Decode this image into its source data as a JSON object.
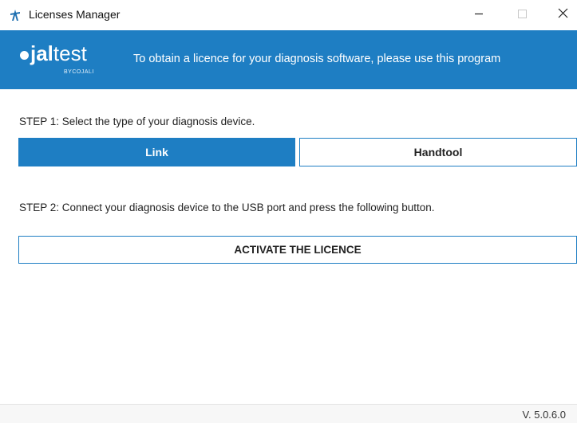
{
  "window": {
    "title": "Licenses Manager",
    "controls": {
      "minimize_icon": "minimize-icon",
      "maximize_icon": "maximize-icon",
      "close_icon": "close-icon"
    }
  },
  "header": {
    "logo": {
      "main_bold": "jal",
      "main_light": "test",
      "sub": "BYCOJALI"
    },
    "tagline": "To obtain a licence for your diagnosis software, please use this program",
    "background_color": "#1e7ec3"
  },
  "step1": {
    "label": "STEP 1: Select the type of your diagnosis device.",
    "options": [
      {
        "label": "Link",
        "selected": true
      },
      {
        "label": "Handtool",
        "selected": false
      }
    ]
  },
  "step2": {
    "label": "STEP 2: Connect your diagnosis device to the USB port and press the following button.",
    "button_label": "ACTIVATE THE LICENCE"
  },
  "footer": {
    "version": "V. 5.0.6.0"
  },
  "colors": {
    "accent": "#1e7ec3",
    "text": "#222222",
    "background": "#ffffff"
  }
}
